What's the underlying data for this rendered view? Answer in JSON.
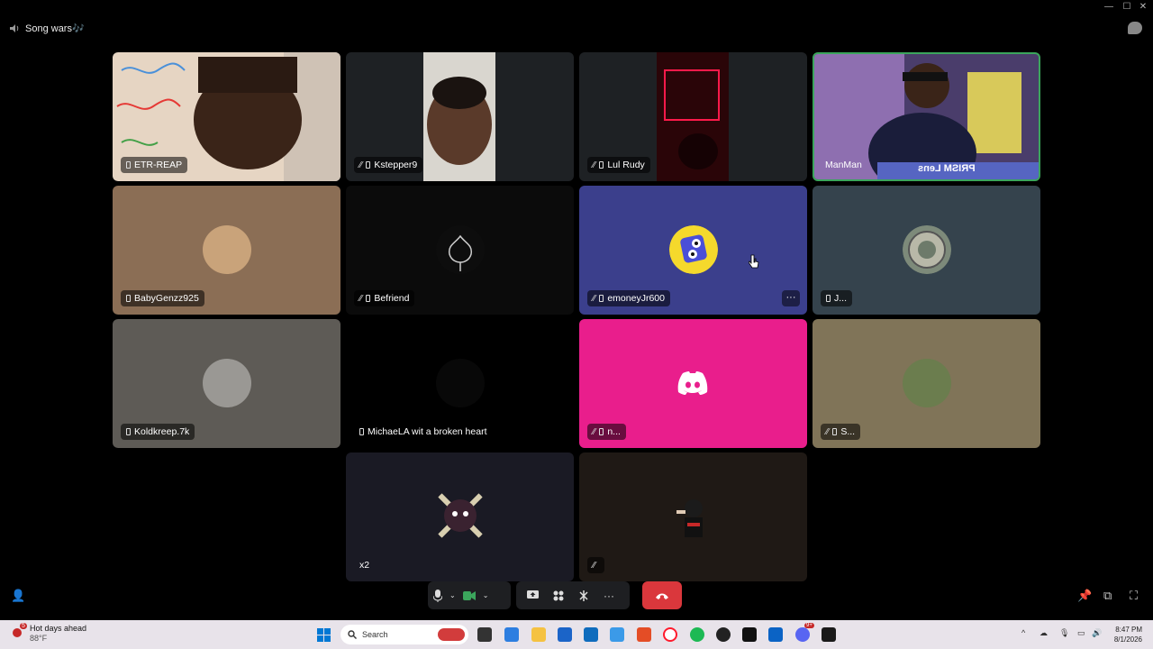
{
  "window": {
    "minimize": "—",
    "maximize": "☐",
    "close": "✕"
  },
  "channel": {
    "name": "Song wars🎶"
  },
  "tiles": [
    {
      "name": "ETR-REAP"
    },
    {
      "name": "Kstepper9"
    },
    {
      "name": "Lul Rudy"
    },
    {
      "name": "ManMan",
      "overlay": "PRISM Lens"
    },
    {
      "name": "BabyGenzz925"
    },
    {
      "name": "Befriend"
    },
    {
      "name": "emoneyJr600"
    },
    {
      "name": "J..."
    },
    {
      "name": "Koldkreep.7k"
    },
    {
      "name": "MichaeLA wit a broken heart"
    },
    {
      "name": "n..."
    },
    {
      "name": "S..."
    },
    {
      "name": "x2"
    },
    {
      "name": ""
    }
  ],
  "tile_more": "···",
  "controls": {
    "more": "···",
    "hangup": "✆"
  },
  "taskbar": {
    "weather_title": "Hot days ahead",
    "weather_temp": "88°F",
    "weather_badge": "5",
    "search_placeholder": "Search",
    "time": "8:47 PM",
    "date": "8/1/2026",
    "discord_badge": "9+"
  },
  "colors": {
    "bg": "#000000",
    "tile_brown": "#8b6e55",
    "tile_blue": "#3b3f8c",
    "tile_slate": "#35434d",
    "tile_gray": "#5e5b56",
    "tile_pink": "#e91e8c",
    "tile_olive": "#807458",
    "hangup": "#da373c"
  }
}
